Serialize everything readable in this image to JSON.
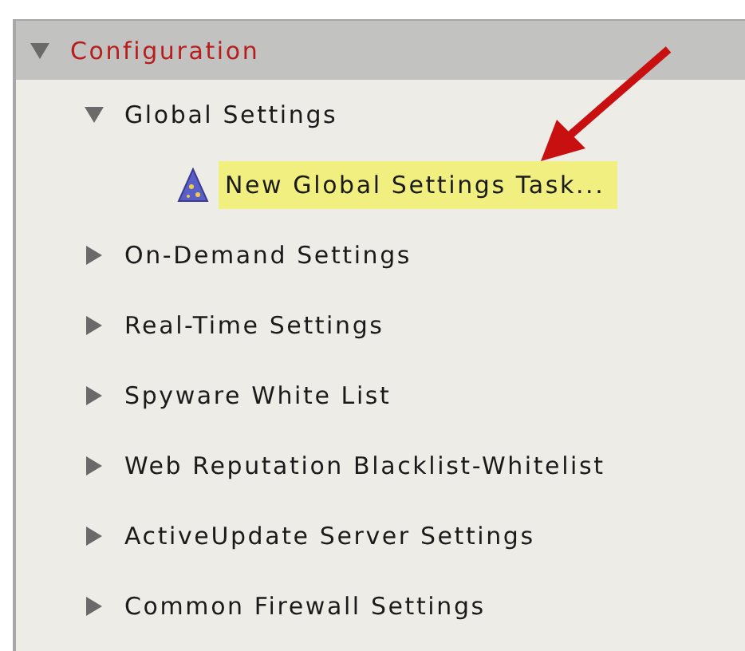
{
  "tree": {
    "label": "Configuration",
    "expanded": true,
    "children": [
      {
        "label": "Global Settings",
        "expanded": true,
        "selected": false,
        "children": [
          {
            "label": "New Global Settings Task...",
            "kind": "task",
            "selected": true
          }
        ]
      },
      {
        "label": "On-Demand Settings",
        "expanded": false,
        "selected": false
      },
      {
        "label": "Real-Time Settings",
        "expanded": false,
        "selected": false
      },
      {
        "label": "Spyware White List",
        "expanded": false,
        "selected": false
      },
      {
        "label": "Web Reputation Blacklist-Whitelist",
        "expanded": false,
        "selected": false
      },
      {
        "label": "ActiveUpdate Server Settings",
        "expanded": false,
        "selected": false
      },
      {
        "label": "Common Firewall Settings",
        "expanded": false,
        "selected": false
      }
    ]
  }
}
